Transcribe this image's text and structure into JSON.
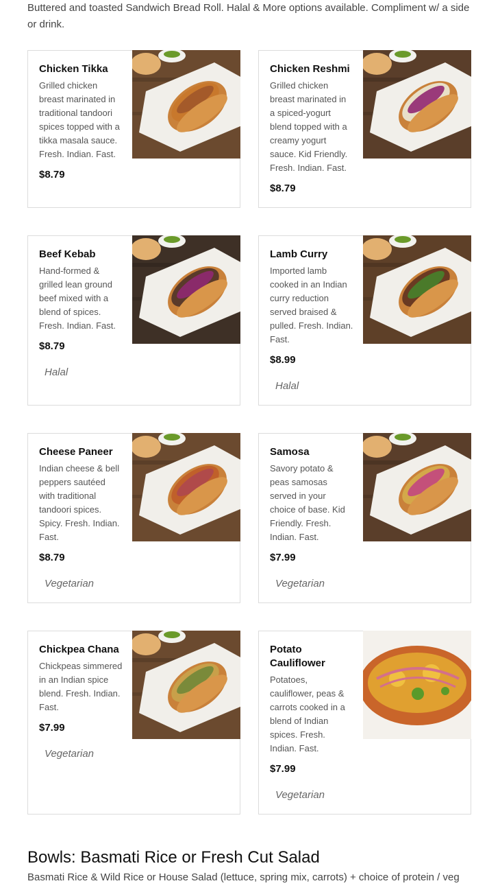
{
  "intro": "Buttered and toasted Sandwich Bread Roll. Halal & More options available. Compliment w/ a side or drink.",
  "items": [
    {
      "name": "Chicken Tikka",
      "desc": "Grilled chicken breast marinated in traditional tandoori spices topped with a tikka masala sauce. Fresh. Indian. Fast.",
      "price": "$8.79",
      "tag": "",
      "sauce": "#c8782c",
      "topping": "#a45a2a",
      "plate": "#f1efea",
      "bg": "#6b4a2f"
    },
    {
      "name": "Chicken Reshmi",
      "desc": "Grilled chicken breast marinated in a spiced-yogurt blend topped with a creamy yogurt sauce. Kid Friendly. Fresh. Indian. Fast.",
      "price": "$8.79",
      "tag": "",
      "sauce": "#e8e0c8",
      "topping": "#9a3a7a",
      "plate": "#f1efea",
      "bg": "#5a3e2a"
    },
    {
      "name": "Beef Kebab",
      "desc": "Hand-formed & grilled lean ground beef mixed with a blend of spices. Fresh. Indian. Fast.",
      "price": "$8.79",
      "tag": "Halal",
      "sauce": "#5a3a2a",
      "topping": "#8a2a6a",
      "plate": "#f1efea",
      "bg": "#3e3026"
    },
    {
      "name": "Lamb Curry",
      "desc": "Imported lamb cooked in an Indian curry reduction served braised & pulled. Fresh. Indian. Fast.",
      "price": "$8.99",
      "tag": "Halal",
      "sauce": "#6a3a22",
      "topping": "#4a7a2a",
      "plate": "#f1efea",
      "bg": "#5e4028"
    },
    {
      "name": "Cheese Paneer",
      "desc": "Indian cheese & bell peppers sautéed with traditional tandoori spices. Spicy. Fresh. Indian. Fast.",
      "price": "$8.79",
      "tag": "Vegetarian",
      "sauce": "#c0602a",
      "topping": "#b04a4a",
      "plate": "#f1efea",
      "bg": "#6b4a2f"
    },
    {
      "name": "Samosa",
      "desc": "Savory potato & peas samosas served in your choice of base. Kid Friendly. Fresh. Indian. Fast.",
      "price": "$7.99",
      "tag": "Vegetarian",
      "sauce": "#d4a84a",
      "topping": "#c4507a",
      "plate": "#f1efea",
      "bg": "#5a3e2a"
    },
    {
      "name": "Chickpea Chana",
      "desc": "Chickpeas simmered in an Indian spice blend. Fresh. Indian. Fast.",
      "price": "$7.99",
      "tag": "Vegetarian",
      "sauce": "#c8a04a",
      "topping": "#7a8a3a",
      "plate": "#f1efea",
      "bg": "#6b4a2f"
    },
    {
      "name": "Potato Cauliflower",
      "desc": "Potatoes, cauliflower, peas & carrots cooked in a blend of Indian spices. Fresh. Indian. Fast.",
      "price": "$7.99",
      "tag": "Vegetarian",
      "sauce": "#e0a030",
      "topping": "#d4708a",
      "plate": "#ffffff",
      "bg": "#f4f1ec"
    }
  ],
  "section": {
    "title": "Bowls: Basmati Rice or Fresh Cut Salad",
    "subtitle": "Basmati Rice & Wild Rice or House Salad (lettuce, spring mix, carrots) + choice of protein / veg"
  }
}
